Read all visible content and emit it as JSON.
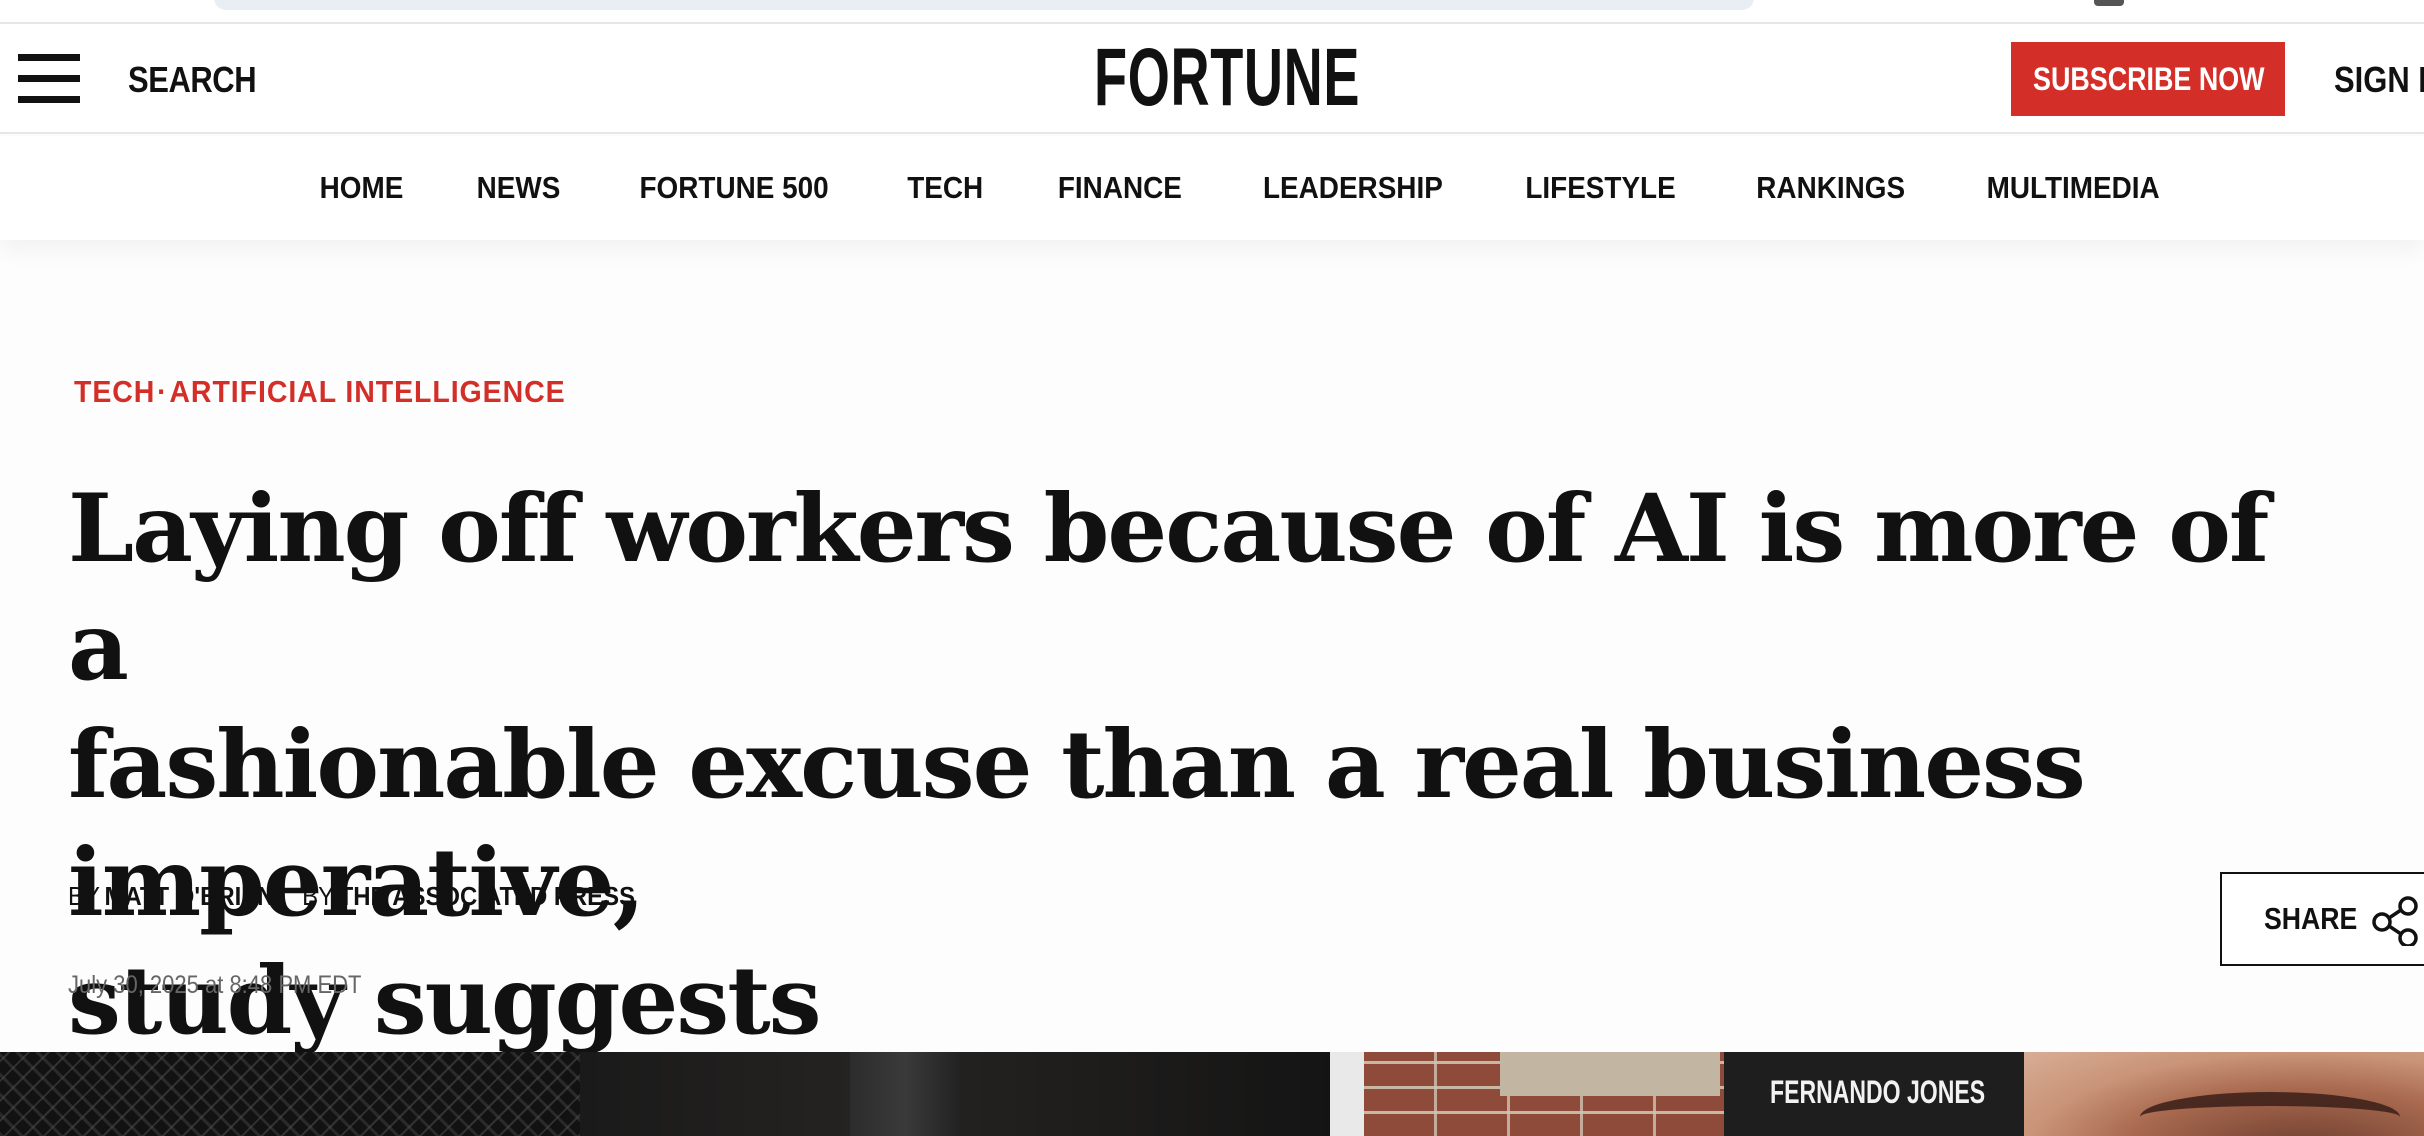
{
  "masthead": {
    "search_label": "SEARCH",
    "logo_text": "FORTUNE",
    "subscribe_label": "SUBSCRIBE NOW",
    "signin_label": "SIGN I"
  },
  "nav": {
    "items": [
      "HOME",
      "NEWS",
      "FORTUNE 500",
      "TECH",
      "FINANCE",
      "LEADERSHIP",
      "LIFESTYLE",
      "RANKINGS",
      "MULTIMEDIA"
    ]
  },
  "article": {
    "kicker_primary": "TECH",
    "kicker_separator": "·",
    "kicker_secondary": "ARTIFICIAL INTELLIGENCE",
    "headline_lines": [
      "Laying off workers because of AI is more of a",
      "fashionable excuse than a real business imperative,",
      "study suggests"
    ],
    "bylines": [
      {
        "prefix": "BY",
        "name": "MATT O'BRIEN"
      },
      {
        "prefix": "BY",
        "name": "THE ASSOCIATED PRESS"
      }
    ],
    "date": "July 30, 2025 at 8:48 PM EDT",
    "share_label": "SHARE"
  },
  "hero": {
    "sign_text": "FERNANDO JONES"
  },
  "colors": {
    "brand_red": "#d32f28",
    "text": "#111111",
    "muted": "#666666"
  },
  "icons": {
    "menu": "hamburger-icon",
    "share": "share-icon"
  }
}
